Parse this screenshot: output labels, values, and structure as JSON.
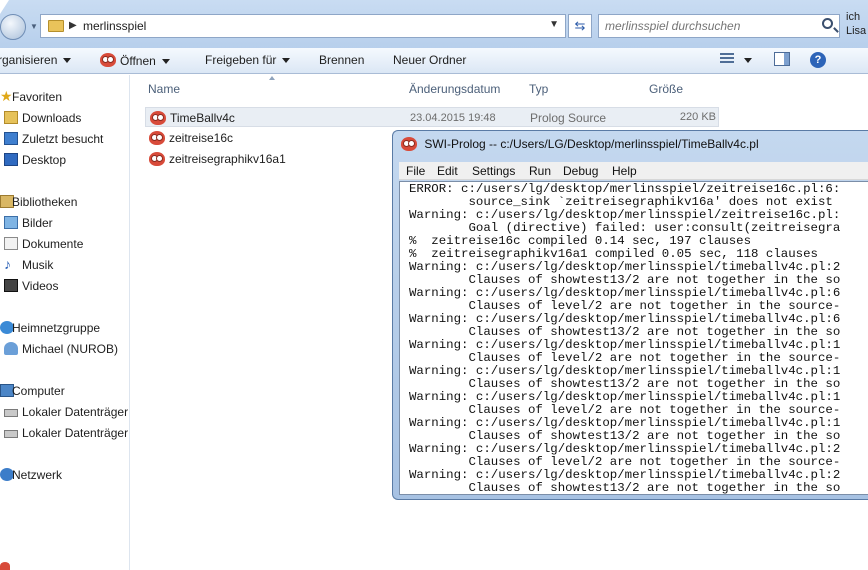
{
  "address_bar": {
    "path_segment": "merlinsspiel",
    "search_placeholder": "merlinsspiel durchsuchen",
    "right_edge_text_1": "ich",
    "right_edge_text_2": "Lisa"
  },
  "toolbar": {
    "organize": "rganisieren",
    "open": "Öffnen",
    "share": "Freigeben für",
    "burn": "Brennen",
    "new_folder": "Neuer Ordner"
  },
  "nav": {
    "favorites": "Favoriten",
    "downloads": "Downloads",
    "recent": "Zuletzt besucht",
    "desktop": "Desktop",
    "libraries": "Bibliotheken",
    "pictures": "Bilder",
    "documents": "Dokumente",
    "music": "Musik",
    "videos": "Videos",
    "homegroup": "Heimnetzgruppe",
    "user": "Michael (NUROB)",
    "computer": "Computer",
    "drive1": "Lokaler Datenträger",
    "drive2": "Lokaler Datenträger",
    "network": "Netzwerk"
  },
  "columns": {
    "name": "Name",
    "modified": "Änderungsdatum",
    "type": "Typ",
    "size": "Größe"
  },
  "files": [
    {
      "name": "TimeBallv4c",
      "date": "23.04.2015 19:48",
      "type": "Prolog Source",
      "size": "220 KB"
    },
    {
      "name": "zeitreise16c"
    },
    {
      "name": "zeitreisegraphikv16a1"
    }
  ],
  "swi": {
    "title": "SWI-Prolog -- c:/Users/LG/Desktop/merlinsspiel/TimeBallv4c.pl",
    "menu": [
      "File",
      "Edit",
      "Settings",
      "Run",
      "Debug",
      "Help"
    ],
    "console": [
      "ERROR: c:/users/lg/desktop/merlinsspiel/zeitreise16c.pl:6:",
      "        source_sink `zeitreisegraphikv16a' does not exist",
      "Warning: c:/users/lg/desktop/merlinsspiel/zeitreise16c.pl:",
      "        Goal (directive) failed: user:consult(zeitreisegra",
      "%  zeitreise16c compiled 0.14 sec, 197 clauses",
      "%  zeitreisegraphikv16a1 compiled 0.05 sec, 118 clauses",
      "Warning: c:/users/lg/desktop/merlinsspiel/timeballv4c.pl:2",
      "        Clauses of showtest13/2 are not together in the so",
      "Warning: c:/users/lg/desktop/merlinsspiel/timeballv4c.pl:6",
      "        Clauses of level/2 are not together in the source-",
      "Warning: c:/users/lg/desktop/merlinsspiel/timeballv4c.pl:6",
      "        Clauses of showtest13/2 are not together in the so",
      "Warning: c:/users/lg/desktop/merlinsspiel/timeballv4c.pl:1",
      "        Clauses of level/2 are not together in the source-",
      "Warning: c:/users/lg/desktop/merlinsspiel/timeballv4c.pl:1",
      "        Clauses of showtest13/2 are not together in the so",
      "Warning: c:/users/lg/desktop/merlinsspiel/timeballv4c.pl:1",
      "        Clauses of level/2 are not together in the source-",
      "Warning: c:/users/lg/desktop/merlinsspiel/timeballv4c.pl:1",
      "        Clauses of showtest13/2 are not together in the so",
      "Warning: c:/users/lg/desktop/merlinsspiel/timeballv4c.pl:2",
      "        Clauses of level/2 are not together in the source-",
      "Warning: c:/users/lg/desktop/merlinsspiel/timeballv4c.pl:2",
      "        Clauses of showtest13/2 are not together in the so"
    ]
  },
  "colors": {
    "accent": "#2d64b8",
    "owl_icon": "#d84b3a"
  }
}
